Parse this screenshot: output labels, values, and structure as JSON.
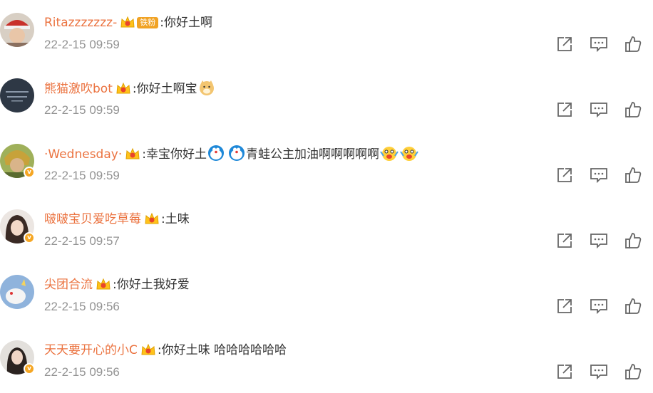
{
  "comments": [
    {
      "username": "Ritazzzzzzz-",
      "fan_badge": "铁粉",
      "text": ":你好土啊",
      "time": "22-2-15 09:59",
      "verified": false,
      "emojis": []
    },
    {
      "username": "熊猫激吹bot",
      "fan_badge": null,
      "text": ":你好土啊宝",
      "time": "22-2-15 09:59",
      "verified": false,
      "emojis": [
        "doge-emoji"
      ]
    },
    {
      "username": "·Wednesday·",
      "fan_badge": null,
      "text": ":幸宝你好土",
      "text2": "青蛙公主加油啊啊啊啊啊",
      "time": "22-2-15 09:59",
      "verified": true,
      "emojis": [
        "doraemon-emoji",
        "doraemon-emoji",
        "excited-emoji",
        "excited-emoji"
      ]
    },
    {
      "username": "啵啵宝贝爱吃草莓",
      "fan_badge": null,
      "text": ":土味",
      "time": "22-2-15 09:57",
      "verified": true,
      "emojis": []
    },
    {
      "username": "尖团合流",
      "fan_badge": null,
      "text": ":你好土我好爱",
      "time": "22-2-15 09:56",
      "verified": false,
      "emojis": []
    },
    {
      "username": "天天要开心的小C",
      "fan_badge": null,
      "text": ":你好土味 哈哈哈哈哈哈",
      "time": "22-2-15 09:56",
      "verified": true,
      "emojis": []
    }
  ],
  "verified_mark": "v",
  "icons": {
    "share": "share-icon",
    "reply": "reply-icon",
    "like": "thumbs-up-icon",
    "crown": "super-fan-crown-icon"
  },
  "colors": {
    "username": "#eb7340",
    "time": "#939393",
    "text": "#333333",
    "fan_badge": "#f1a325",
    "icon": "#666666"
  }
}
